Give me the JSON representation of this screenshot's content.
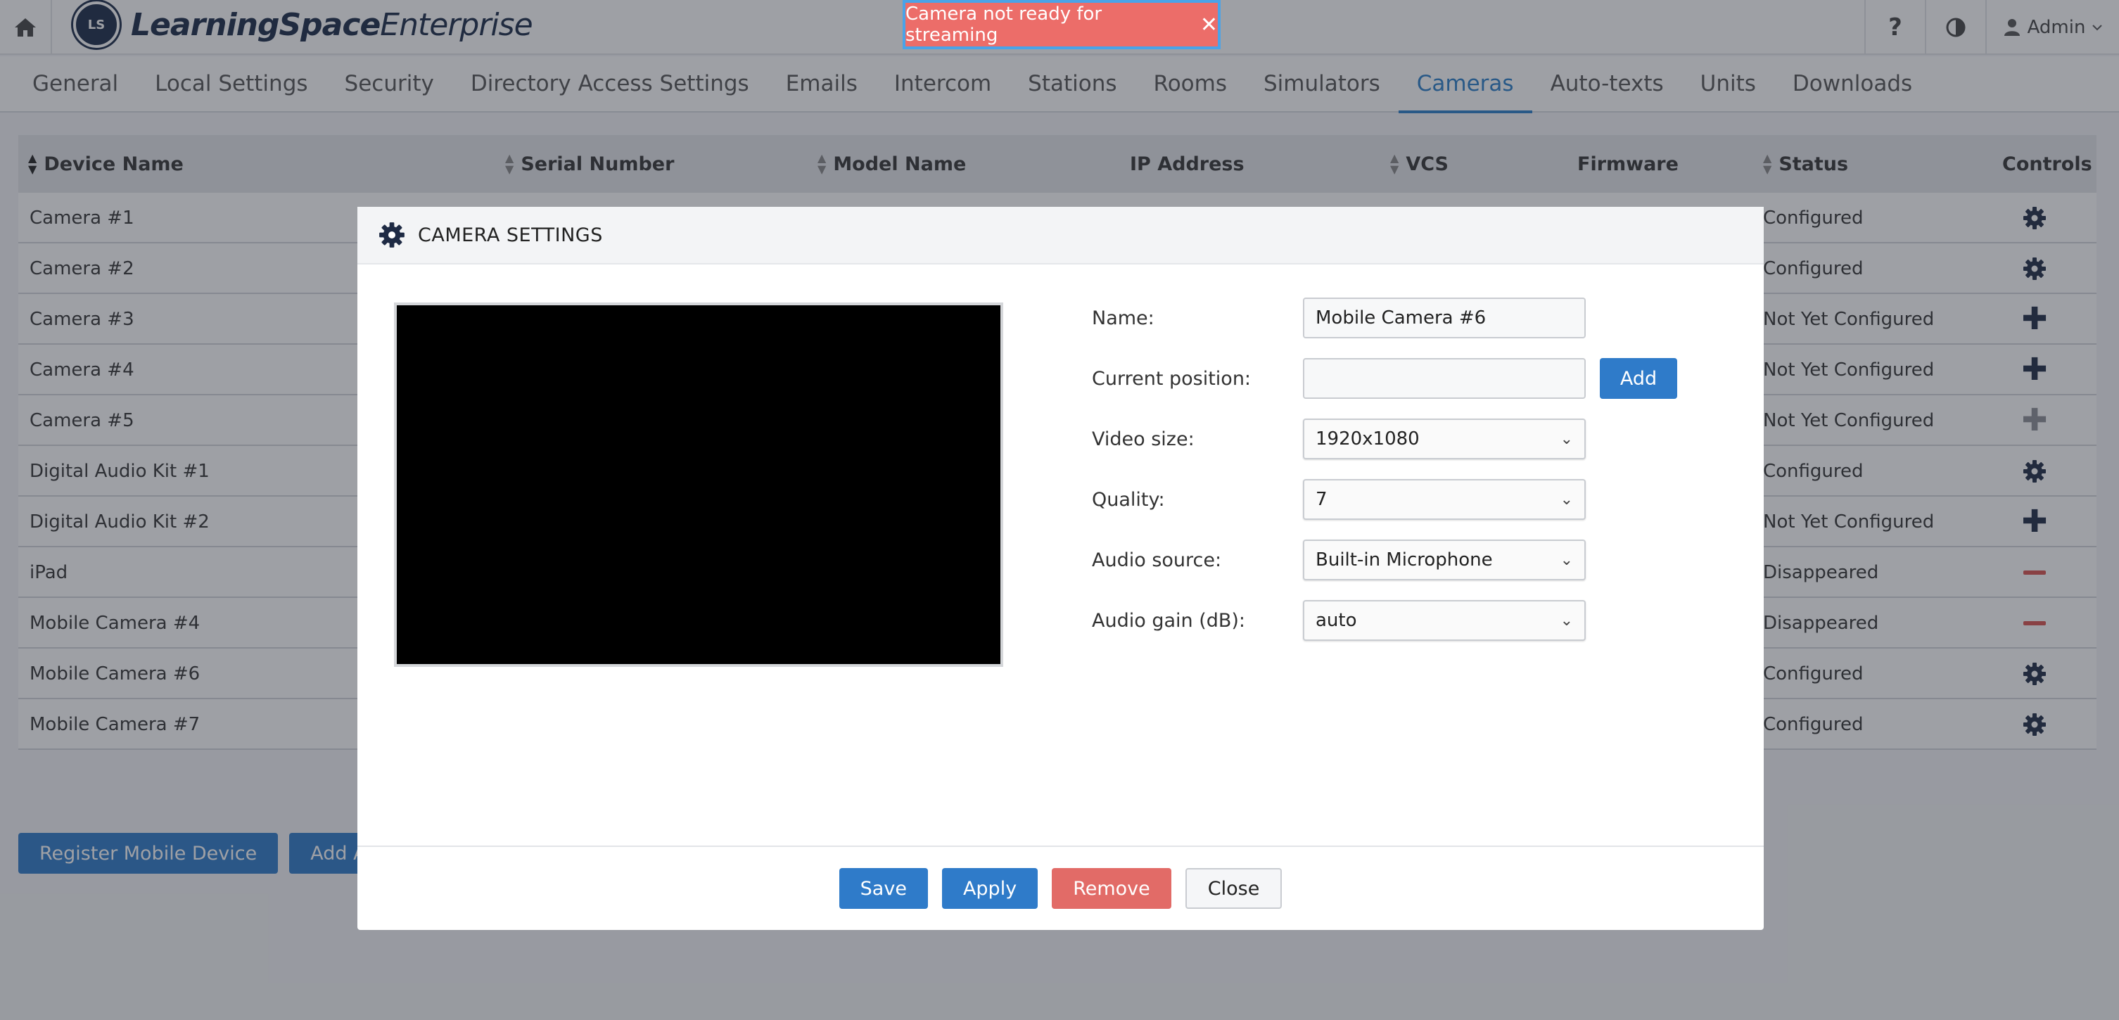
{
  "app": {
    "logo_text_bold": "LearningSpace",
    "logo_text_regular": "Enterprise",
    "logo_mark": "LS"
  },
  "topbar": {
    "help_label": "?",
    "user_label": "Admin",
    "icons": [
      "home-icon",
      "contrast-icon",
      "user-icon",
      "caret-down-icon"
    ]
  },
  "tabs": [
    {
      "label": "General"
    },
    {
      "label": "Local Settings"
    },
    {
      "label": "Security"
    },
    {
      "label": "Directory Access Settings"
    },
    {
      "label": "Emails"
    },
    {
      "label": "Intercom"
    },
    {
      "label": "Stations"
    },
    {
      "label": "Rooms"
    },
    {
      "label": "Simulators"
    },
    {
      "label": "Cameras",
      "active": true
    },
    {
      "label": "Auto-texts"
    },
    {
      "label": "Units"
    },
    {
      "label": "Downloads"
    }
  ],
  "table": {
    "columns": {
      "device_name": "Device Name",
      "serial_number": "Serial Number",
      "model_name": "Model Name",
      "ip_address": "IP Address",
      "vcs": "VCS",
      "firmware": "Firmware",
      "status": "Status",
      "controls": "Controls"
    },
    "rows": [
      {
        "name": "Camera #1",
        "status": "Configured",
        "control": "gear"
      },
      {
        "name": "Camera #2",
        "status": "Configured",
        "control": "gear"
      },
      {
        "name": "Camera #3",
        "status": "Not Yet Configured",
        "control": "plus"
      },
      {
        "name": "Camera #4",
        "status": "Not Yet Configured",
        "control": "plus"
      },
      {
        "name": "Camera #5",
        "status": "Not Yet Configured",
        "control": "plus-disabled"
      },
      {
        "name": "Digital Audio Kit #1",
        "status": "Configured",
        "control": "gear"
      },
      {
        "name": "Digital Audio Kit #2",
        "status": "Not Yet Configured",
        "control": "plus"
      },
      {
        "name": "iPad",
        "status": "Disappeared",
        "control": "minus"
      },
      {
        "name": "Mobile Camera #4",
        "status": "Disappeared",
        "control": "minus"
      },
      {
        "name": "Mobile Camera #6",
        "status": "Configured",
        "control": "gear"
      },
      {
        "name": "Mobile Camera #7",
        "status": "Configured",
        "control": "gear"
      }
    ]
  },
  "bottom_buttons": {
    "register": "Register Mobile Device",
    "add_all": "Add All"
  },
  "modal": {
    "title": "CAMERA SETTINGS",
    "fields": {
      "name_label": "Name:",
      "name_value": "Mobile Camera #6",
      "position_label": "Current position:",
      "position_value": "",
      "add_label": "Add",
      "video_size_label": "Video size:",
      "video_size_value": "1920x1080",
      "quality_label": "Quality:",
      "quality_value": "7",
      "audio_source_label": "Audio source:",
      "audio_source_value": "Built-in Microphone",
      "audio_gain_label": "Audio gain (dB):",
      "audio_gain_value": "auto"
    },
    "footer": {
      "save": "Save",
      "apply": "Apply",
      "remove": "Remove",
      "close": "Close"
    }
  },
  "toast": {
    "message": "Camera not ready for streaming",
    "close_glyph": "✕"
  },
  "colors": {
    "accent": "#2f7bc9",
    "danger": "#e26b67",
    "toast_bg": "#ec6d69",
    "navy": "#1e2a44"
  }
}
